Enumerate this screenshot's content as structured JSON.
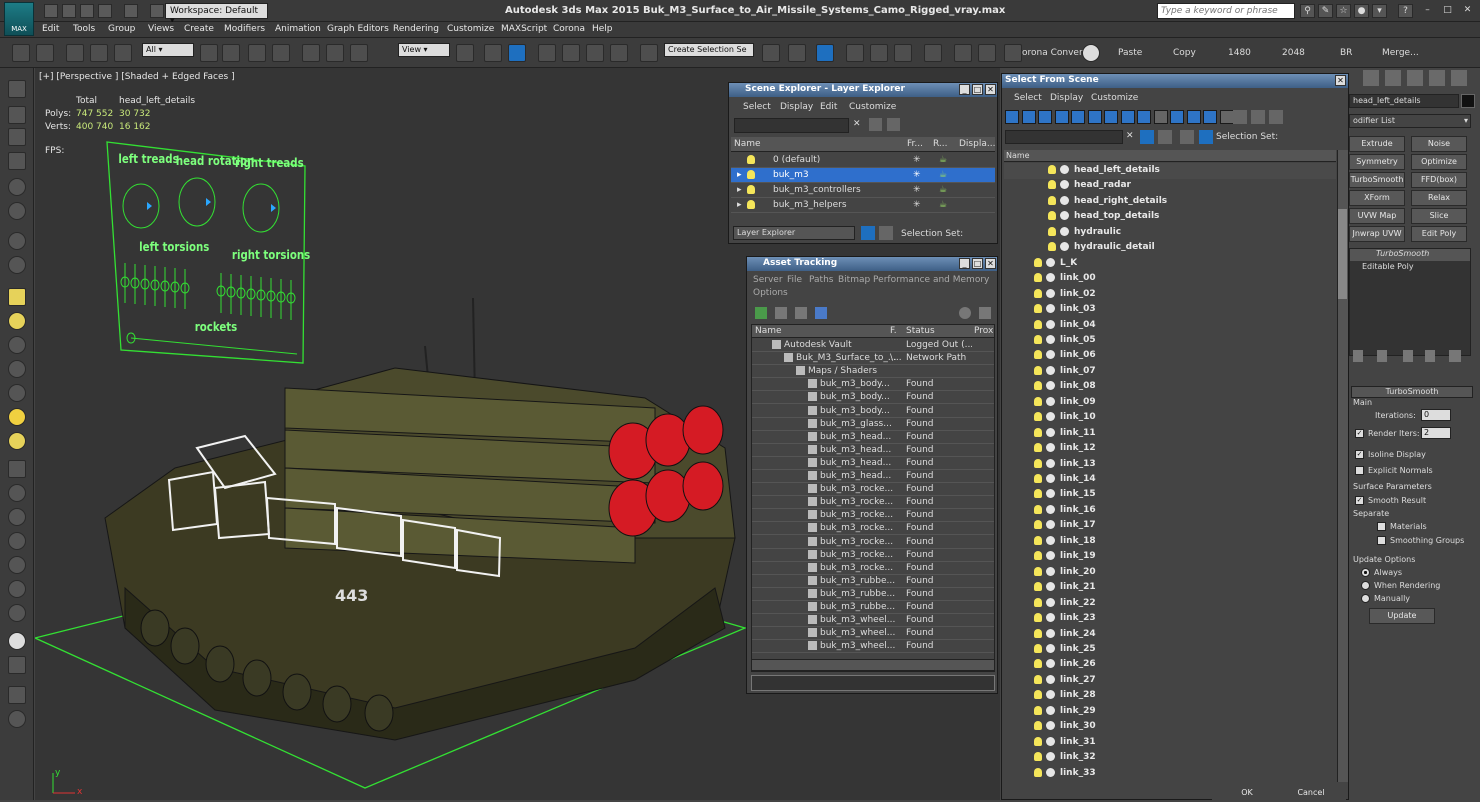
{
  "app": {
    "title": "Autodesk 3ds Max  2015    Buk_M3_Surface_to_Air_Missile_Systems_Camo_Rigged_vray.max",
    "logo_label": "MAX",
    "workspace": "Workspace: Default",
    "search_placeholder": "Type a keyword or phrase"
  },
  "menu": [
    "Edit",
    "Tools",
    "Group",
    "Views",
    "Create",
    "Modifiers",
    "Animation",
    "Graph Editors",
    "Rendering",
    "Customize",
    "MAXScript",
    "Corona",
    "Help"
  ],
  "toolbar": {
    "filter": "All",
    "ref_coord": "View",
    "selection_set": "Create Selection Se",
    "labels": [
      "orona Convert",
      "Paste",
      "Copy",
      "1480",
      "2048",
      "BR",
      "Merge..."
    ]
  },
  "viewport": {
    "label": "[+] [Perspective ] [Shaded + Edged Faces ]",
    "stats": {
      "total_label": "Total",
      "selected_label": "head_left_details",
      "polys_label": "Polys:",
      "polys_total": "747 552",
      "polys_sel": "30 732",
      "verts_label": "Verts:",
      "verts_total": "400 740",
      "verts_sel": "16 162",
      "fps_label": "FPS:"
    },
    "rig": {
      "left_treads": "left treads",
      "head_rotation": "head rotation",
      "right_treads": "right treads",
      "left_torsions": "left torsions",
      "right_torsions": "right torsions",
      "rockets": "rockets"
    },
    "hull_marking": "443",
    "axis_y": "y",
    "axis_x": "x"
  },
  "scene_explorer": {
    "title": "Scene Explorer - Layer Explorer",
    "menu": [
      "Select",
      "Display",
      "Edit",
      "Customize"
    ],
    "columns": [
      "Name",
      "Fr...",
      "R...",
      "Displa..."
    ],
    "rows": [
      "0 (default)",
      "buk_m3",
      "buk_m3_controllers",
      "buk_m3_helpers"
    ],
    "selected_row": 1,
    "footer_dropdown": "Layer Explorer",
    "footer_label": "Selection Set:"
  },
  "asset_tracking": {
    "title": "Asset Tracking",
    "menu": [
      "Server",
      "File",
      "Paths",
      "Bitmap Performance and Memory",
      "Options"
    ],
    "columns": [
      "Name",
      "F.",
      "Status",
      "Prox"
    ],
    "rows": [
      {
        "name": "Autodesk Vault",
        "f": "",
        "status": "Logged Out (...",
        "indent": 1
      },
      {
        "name": "Buk_M3_Surface_to_...",
        "f": "\\...",
        "status": "Network Path",
        "indent": 2
      },
      {
        "name": "Maps / Shaders",
        "f": "",
        "status": "",
        "indent": 3
      },
      {
        "name": "buk_m3_body...",
        "f": "",
        "status": "Found",
        "indent": 4
      },
      {
        "name": "buk_m3_body...",
        "f": "",
        "status": "Found",
        "indent": 4
      },
      {
        "name": "buk_m3_body...",
        "f": "",
        "status": "Found",
        "indent": 4
      },
      {
        "name": "buk_m3_glass...",
        "f": "",
        "status": "Found",
        "indent": 4
      },
      {
        "name": "buk_m3_head...",
        "f": "",
        "status": "Found",
        "indent": 4
      },
      {
        "name": "buk_m3_head...",
        "f": "",
        "status": "Found",
        "indent": 4
      },
      {
        "name": "buk_m3_head...",
        "f": "",
        "status": "Found",
        "indent": 4
      },
      {
        "name": "buk_m3_head...",
        "f": "",
        "status": "Found",
        "indent": 4
      },
      {
        "name": "buk_m3_rocke...",
        "f": "",
        "status": "Found",
        "indent": 4
      },
      {
        "name": "buk_m3_rocke...",
        "f": "",
        "status": "Found",
        "indent": 4
      },
      {
        "name": "buk_m3_rocke...",
        "f": "",
        "status": "Found",
        "indent": 4
      },
      {
        "name": "buk_m3_rocke...",
        "f": "",
        "status": "Found",
        "indent": 4
      },
      {
        "name": "buk_m3_rocke...",
        "f": "",
        "status": "Found",
        "indent": 4
      },
      {
        "name": "buk_m3_rocke...",
        "f": "",
        "status": "Found",
        "indent": 4
      },
      {
        "name": "buk_m3_rocke...",
        "f": "",
        "status": "Found",
        "indent": 4
      },
      {
        "name": "buk_m3_rubbe...",
        "f": "",
        "status": "Found",
        "indent": 4
      },
      {
        "name": "buk_m3_rubbe...",
        "f": "",
        "status": "Found",
        "indent": 4
      },
      {
        "name": "buk_m3_rubbe...",
        "f": "",
        "status": "Found",
        "indent": 4
      },
      {
        "name": "buk_m3_wheel...",
        "f": "",
        "status": "Found",
        "indent": 4
      },
      {
        "name": "buk_m3_wheel...",
        "f": "",
        "status": "Found",
        "indent": 4
      },
      {
        "name": "buk_m3_wheel...",
        "f": "",
        "status": "Found",
        "indent": 4
      }
    ]
  },
  "select_from_scene": {
    "title": "Select From Scene",
    "menu": [
      "Select",
      "Display",
      "Customize"
    ],
    "selection_set_label": "Selection Set:",
    "column": "Name",
    "children": [
      "head_left_details",
      "head_radar",
      "head_right_details",
      "head_top_details",
      "hydraulic",
      "hydraulic_detail"
    ],
    "items": [
      "L_K",
      "link_00",
      "link_02",
      "link_03",
      "link_04",
      "link_05",
      "link_06",
      "link_07",
      "link_08",
      "link_09",
      "link_10",
      "link_11",
      "link_12",
      "link_13",
      "link_14",
      "link_15",
      "link_16",
      "link_17",
      "link_18",
      "link_19",
      "link_20",
      "link_21",
      "link_22",
      "link_23",
      "link_24",
      "link_25",
      "link_26",
      "link_27",
      "link_28",
      "link_29",
      "link_30",
      "link_31",
      "link_32",
      "link_33"
    ],
    "ok": "OK",
    "cancel": "Cancel"
  },
  "command_panel": {
    "object_name": "head_left_details",
    "modifier_list": "odifier List",
    "buttons": [
      "Extrude",
      "Noise",
      "Symmetry",
      "Optimize",
      "TurboSmooth",
      "FFD(box)",
      "XForm",
      "Relax",
      "UVW Map",
      "Slice",
      "Jnwrap UVW",
      "Edit Poly"
    ],
    "stack": [
      "TurboSmooth",
      "Editable Poly"
    ],
    "rollout_title": "TurboSmooth",
    "main_label": "Main",
    "iterations_label": "Iterations:",
    "iterations": "0",
    "render_iters_label": "Render Iters:",
    "render_iters": "2",
    "isoline": "Isoline Display",
    "explicit_normals": "Explicit Normals",
    "surface_params": "Surface Parameters",
    "smooth_result": "Smooth Result",
    "separate": "Separate",
    "materials": "Materials",
    "smoothing_groups": "Smoothing Groups",
    "update_options": "Update Options",
    "always": "Always",
    "when_rendering": "When Rendering",
    "manually": "Manually",
    "update": "Update"
  }
}
